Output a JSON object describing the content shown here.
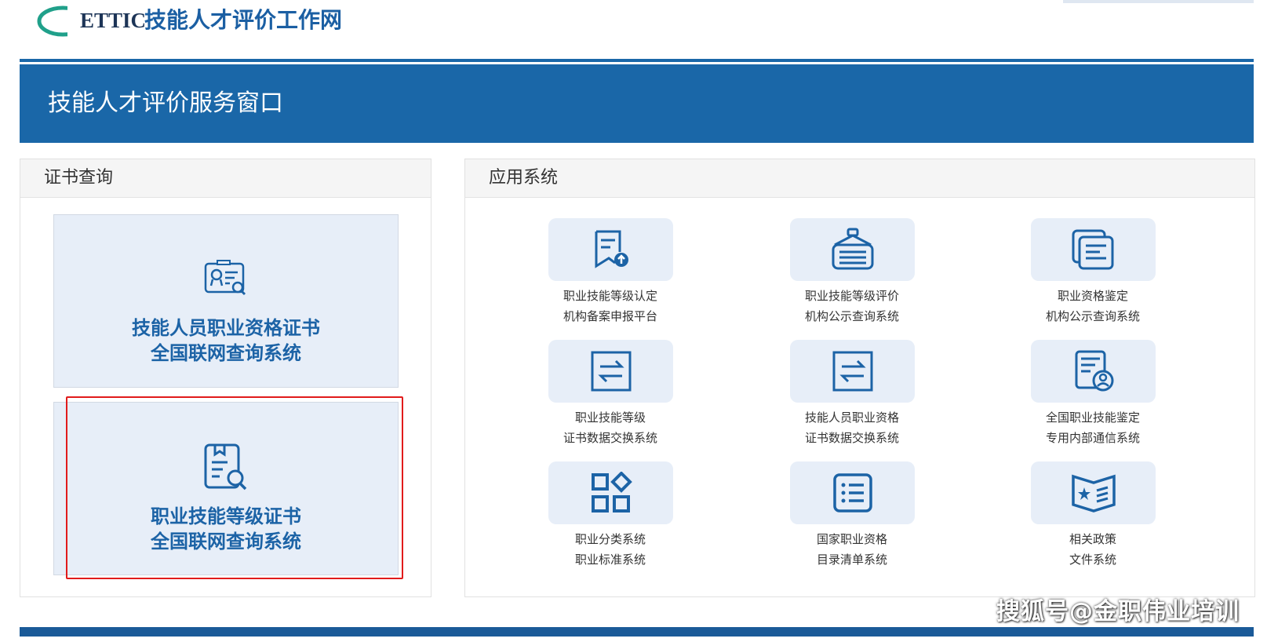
{
  "header": {
    "logo_text": "ETTIC",
    "site_title": "技能人才评价工作网"
  },
  "banner": {
    "title": "技能人才评价服务窗口"
  },
  "cert_panel": {
    "title": "证书查询",
    "cards": [
      {
        "line1": "技能人员职业资格证书",
        "line2": "全国联网查询系统",
        "icon": "certificate-search-icon"
      },
      {
        "line1": "职业技能等级证书",
        "line2": "全国联网查询系统",
        "icon": "document-search-icon"
      }
    ]
  },
  "apps_panel": {
    "title": "应用系统",
    "apps": [
      {
        "line1": "职业技能等级认定",
        "line2": "机构备案申报平台",
        "icon": "document-upload-icon"
      },
      {
        "line1": "职业技能等级评价",
        "line2": "机构公示查询系统",
        "icon": "notice-board-icon"
      },
      {
        "line1": "职业资格鉴定",
        "line2": "机构公示查询系统",
        "icon": "stacked-documents-icon"
      },
      {
        "line1": "职业技能等级",
        "line2": "证书数据交换系统",
        "icon": "exchange-icon"
      },
      {
        "line1": "技能人员职业资格",
        "line2": "证书数据交换系统",
        "icon": "exchange-icon"
      },
      {
        "line1": "全国职业技能鉴定",
        "line2": "专用内部通信系统",
        "icon": "document-user-icon"
      },
      {
        "line1": "职业分类系统",
        "line2": "职业标准系统",
        "icon": "category-grid-icon"
      },
      {
        "line1": "国家职业资格",
        "line2": "目录清单系统",
        "icon": "list-icon"
      },
      {
        "line1": "相关政策",
        "line2": "文件系统",
        "icon": "policy-book-icon"
      }
    ]
  },
  "watermark": "搜狐号@金职伟业培训",
  "colors": {
    "brand_blue": "#1a67a8",
    "tile_bg": "#e7eef8",
    "highlight_red": "#e11b1b"
  }
}
